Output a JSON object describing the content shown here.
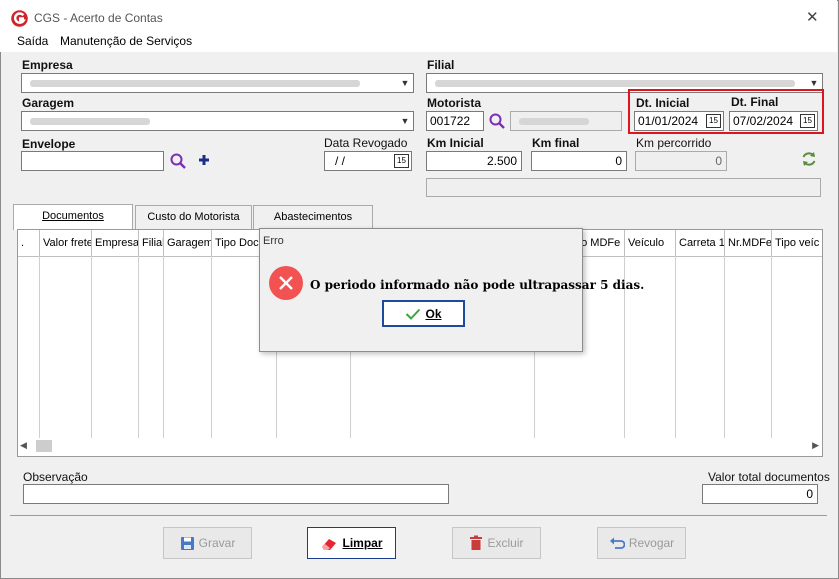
{
  "window": {
    "title": "CGS - Acerto de Contas"
  },
  "menu": {
    "items": [
      "Saída",
      "Manutenção de Serviços"
    ]
  },
  "form": {
    "empresa_label": "Empresa",
    "filial_label": "Filial",
    "garagem_label": "Garagem",
    "motorista_label": "Motorista",
    "motorista_code": "001722",
    "dt_inicial_label": "Dt. Inicial",
    "dt_inicial_value": "01/01/2024",
    "dt_final_label": "Dt. Final",
    "dt_final_value": "07/02/2024",
    "envelope_label": "Envelope",
    "data_revogado_label": "Data Revogado",
    "data_revogado_value": "/ /",
    "km_inicial_label": "Km Inicial",
    "km_inicial_value": "2.500",
    "km_final_label": "Km final",
    "km_final_value": "0",
    "km_percorrido_label": "Km percorrido",
    "km_percorrido_value": "0",
    "calendar_glyph": "15"
  },
  "tabs": [
    "Documentos",
    "Custo do Motorista",
    "Abastecimentos"
  ],
  "grid": {
    "columns": [
      ".",
      "Valor frete",
      "Empresa",
      "Filial",
      "Garagem",
      "Tipo Doc",
      "",
      "",
      "ão MDFe",
      "Veículo",
      "Carreta 1",
      "Nr.MDFe",
      "Tipo veíc"
    ]
  },
  "footer": {
    "observacao_label": "Observação",
    "valor_total_label": "Valor total documentos",
    "valor_total_value": "0"
  },
  "buttons": {
    "gravar": "Gravar",
    "limpar": "Limpar",
    "excluir": "Excluir",
    "revogar": "Revogar"
  },
  "dialog": {
    "title": "Erro",
    "message": "O periodo informado não pode ultrapassar 5 dias.",
    "ok": "Ok"
  }
}
